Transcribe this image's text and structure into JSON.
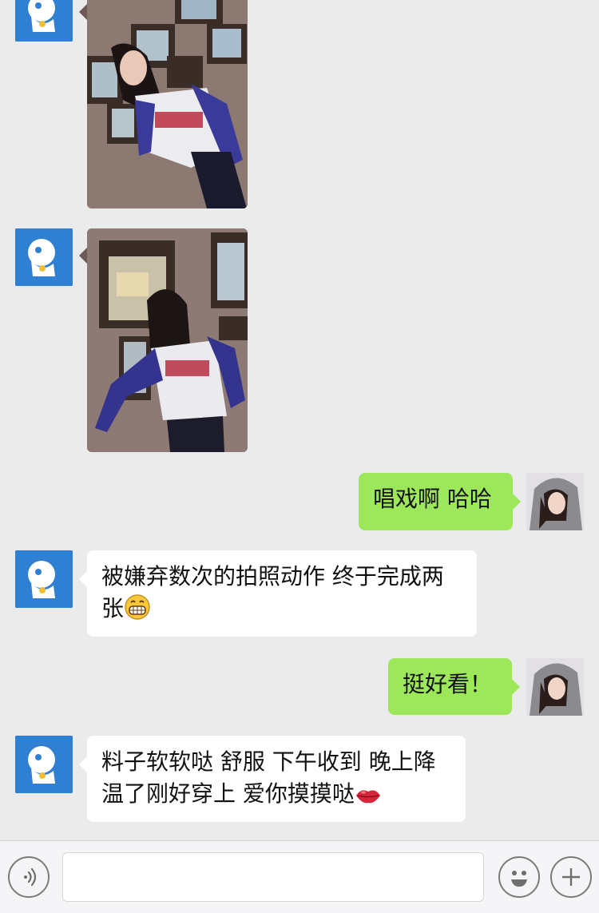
{
  "messages": [
    {
      "side": "left",
      "type": "image",
      "avatar": "doraemon-avatar"
    },
    {
      "side": "left",
      "type": "image",
      "avatar": "doraemon-avatar"
    },
    {
      "side": "right",
      "type": "text",
      "text": "唱戏啊 哈哈",
      "avatar": "hooded-girl-avatar"
    },
    {
      "side": "left",
      "type": "text",
      "line1": "被嫌弃数次的拍照动作 终于完成两",
      "line2": "张",
      "emoji": "grin-emoji",
      "avatar": "doraemon-avatar"
    },
    {
      "side": "right",
      "type": "text",
      "text": "挺好看！",
      "avatar": "hooded-girl-avatar"
    },
    {
      "side": "left",
      "type": "text",
      "line1": "料子软软哒 舒服 下午收到 晚上降",
      "line2": "温了刚好穿上 爱你摸摸哒",
      "emoji": "lips-emoji",
      "avatar": "doraemon-avatar"
    }
  ],
  "input_bar": {
    "voice_icon": "voice-icon",
    "emoji_icon": "smiley-icon",
    "plus_icon": "plus-icon",
    "text_value": ""
  },
  "colors": {
    "background": "#ebebeb",
    "sent_bubble": "#9de85a",
    "received_bubble": "#ffffff",
    "avatar_blue": "#2f7fd3"
  }
}
